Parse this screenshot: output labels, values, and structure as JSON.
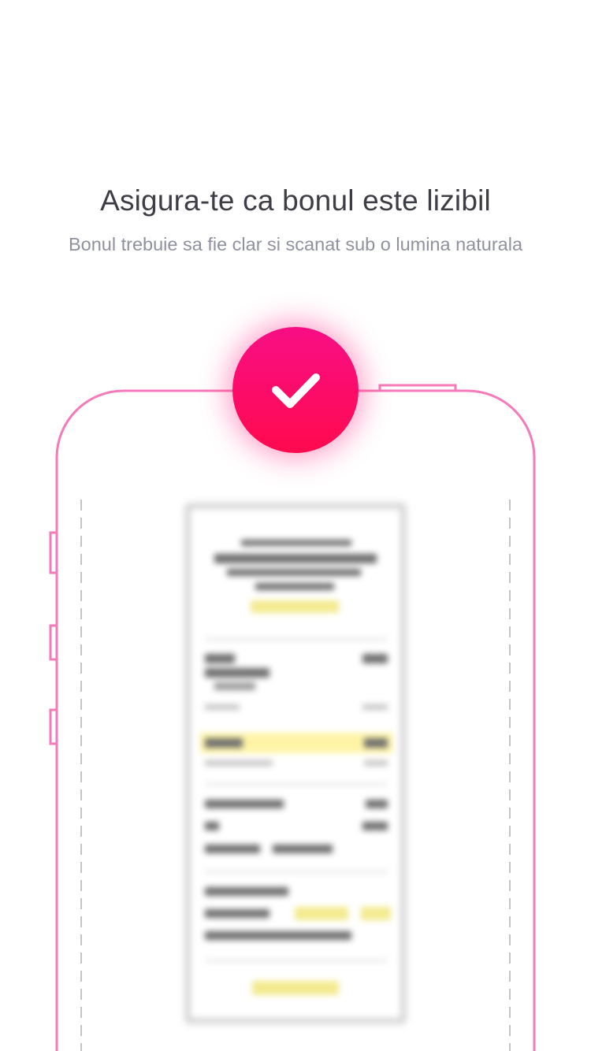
{
  "header": {
    "title": "Asigura-te ca bonul este lizibil",
    "subtitle": "Bonul trebuie sa fie clar si scanat sub o lumina naturala"
  },
  "illustration": {
    "outline_color": "#f47ab9",
    "badge_color_top": "#f80e85",
    "badge_color_bottom": "#ff0a4e",
    "badge_icon": "checkmark-icon",
    "receipt_state": "blurred"
  }
}
